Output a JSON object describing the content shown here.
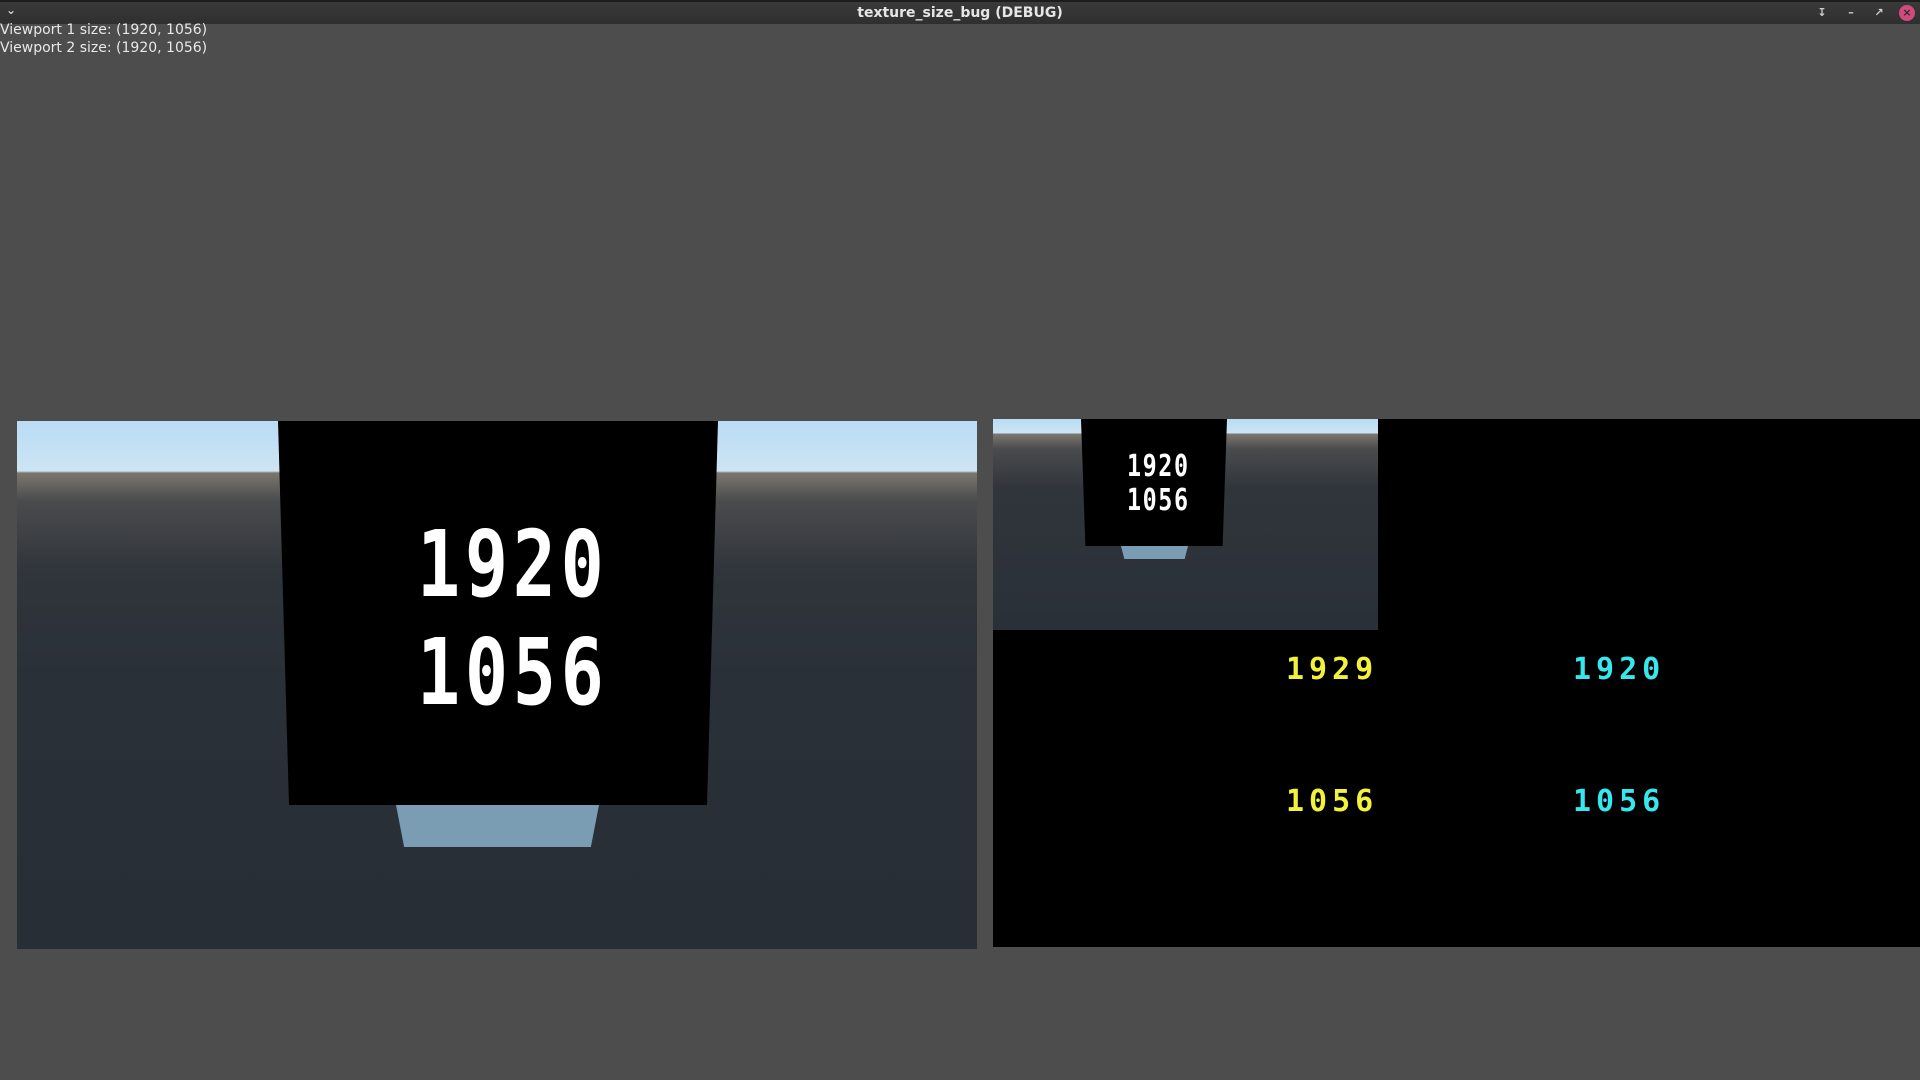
{
  "window": {
    "title": "texture_size_bug (DEBUG)",
    "menu_icon": "chevron-down-icon",
    "pin_icon": "pin-icon",
    "minimize_icon": "minimize-icon",
    "maximize_icon": "maximize-icon",
    "close_icon": "close-icon",
    "close_color": "#d14a7e"
  },
  "info": {
    "viewport1": "Viewport 1 size: (1920, 1056)",
    "viewport2": "Viewport 2 size: (1920, 1056)"
  },
  "viewport1": {
    "panel_width": "1920",
    "panel_height": "1056"
  },
  "viewport2": {
    "panel_width": "1920",
    "panel_height": "1056",
    "yellow_width": "1929",
    "yellow_height": "1056",
    "cyan_width": "1920",
    "cyan_height": "1056",
    "yellow_color": "#f2f23a",
    "cyan_color": "#36e8ee"
  }
}
